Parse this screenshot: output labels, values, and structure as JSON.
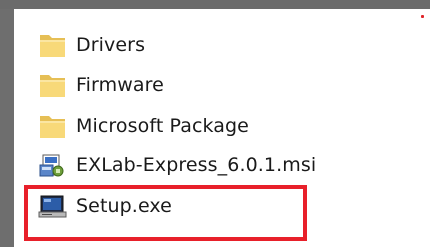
{
  "files": [
    {
      "name": "Drivers",
      "icon": "folder-icon"
    },
    {
      "name": "Firmware",
      "icon": "folder-icon"
    },
    {
      "name": "Microsoft Package",
      "icon": "folder-icon"
    },
    {
      "name": "EXLab-Express_6.0.1.msi",
      "icon": "msi-installer-icon"
    },
    {
      "name": "Setup.exe",
      "icon": "exe-application-icon"
    }
  ],
  "highlight": {
    "target": "Setup.exe",
    "color": "#e8202a"
  },
  "colors": {
    "folder": "#f7d774",
    "folder_dark": "#e0b743",
    "background": "#ffffff",
    "frame": "#6e6e6e"
  }
}
